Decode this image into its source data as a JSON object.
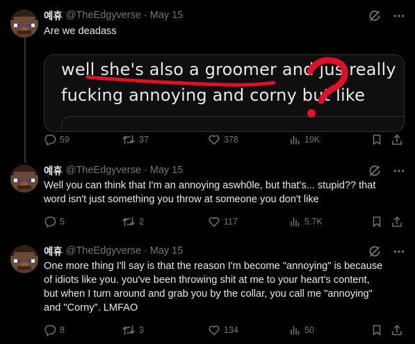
{
  "colors": {
    "background": "#000000",
    "text": "#e7e9ea",
    "muted": "#71767b",
    "annotation_red": "#e0102a",
    "border": "#2f3336"
  },
  "icons": {
    "reply": "comment-bubble-icon",
    "retweet": "retweet-arrows-icon",
    "like": "heart-icon",
    "views": "bar-chart-icon",
    "bookmark": "bookmark-icon",
    "share": "share-upload-icon",
    "grok": "grok-slash-icon",
    "more": "more-dots-icon"
  },
  "tweets": [
    {
      "name": "예휴",
      "handle": "@TheEdgyverse",
      "dot": "·",
      "date": "May 15",
      "text": [
        "Are we deadass"
      ],
      "media": {
        "line1": "well she's also a groomer and jus really",
        "line2": "fucking annoying and corny but like",
        "annotation": "?"
      },
      "stats": {
        "replies": "59",
        "retweets": "37",
        "likes": "378",
        "views": "19K"
      }
    },
    {
      "name": "예휴",
      "handle": "@TheEdgyverse",
      "dot": "·",
      "date": "May 15",
      "text": [
        "Well you can think that I'm an annoying aswh0le, but that's... stupid?? that",
        "word isn't just something you throw at someone you don't like"
      ],
      "stats": {
        "replies": "5",
        "retweets": "2",
        "likes": "117",
        "views": "5.7K"
      }
    },
    {
      "name": "예휴",
      "handle": "@TheEdgyverse",
      "dot": "·",
      "date": "May 15",
      "text": [
        "One more thing I'll say is that the reason I'm become \"annoying\" is because",
        "of idiots like you. you've been throwing shit at me to your heart's content,",
        "but when I turn around and grab you by the collar, you call me \"annoying\"",
        "and \"Corny\". LMFAO"
      ],
      "stats": {
        "replies": "8",
        "retweets": "3",
        "likes": "134",
        "views": "50"
      }
    }
  ]
}
